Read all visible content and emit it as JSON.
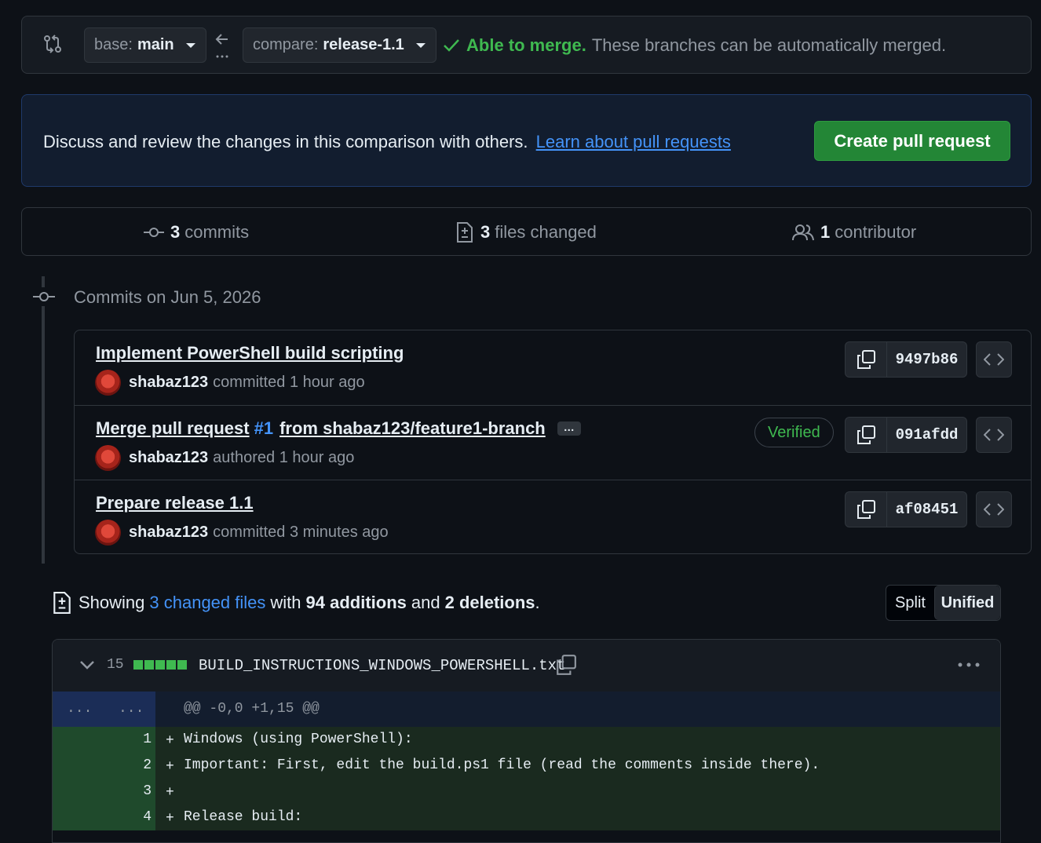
{
  "range": {
    "base_label": "base:",
    "base_branch": "main",
    "compare_label": "compare:",
    "compare_branch": "release-1.1",
    "merge_status": "Able to merge.",
    "merge_desc": "These branches can be automatically merged."
  },
  "blankslate": {
    "message": "Discuss and review the changes in this comparison with others.",
    "link": "Learn about pull requests",
    "button": "Create pull request"
  },
  "summary": {
    "commits_count": "3",
    "commits_label": "commits",
    "files_count": "3",
    "files_label": "files changed",
    "contributors_count": "1",
    "contributors_label": "contributor"
  },
  "timeline": {
    "title": "Commits on Jun 5, 2026"
  },
  "commits": [
    {
      "title": "Implement PowerShell build scripting",
      "author": "shabaz123",
      "action": "committed",
      "time": "1 hour ago",
      "sha": "9497b86"
    },
    {
      "title_pre": "Merge pull request",
      "pr_number": "#1",
      "title_post": "from shabaz123/feature1-branch",
      "ellipsis": "…",
      "author": "shabaz123",
      "action": "authored",
      "time": "1 hour ago",
      "badge": "Verified",
      "sha": "091afdd"
    },
    {
      "title": "Prepare release 1.1",
      "author": "shabaz123",
      "action": "committed",
      "time": "3 minutes ago",
      "sha": "af08451"
    }
  ],
  "diffstat": {
    "showing": "Showing",
    "files_link": "3 changed files",
    "with": "with",
    "additions": "94 additions",
    "and": "and",
    "deletions": "2 deletions",
    "period": ".",
    "split": "Split",
    "unified": "Unified"
  },
  "file": {
    "change_count": "15",
    "name": "BUILD_INSTRUCTIONS_WINDOWS_POWERSHELL.txt",
    "hunk_left": "...",
    "hunk_right": "...",
    "hunk_header": "@@ -0,0 +1,15 @@",
    "lines": [
      {
        "num": "1",
        "sign": "+",
        "text": "Windows (using PowerShell):"
      },
      {
        "num": "2",
        "sign": "+",
        "text": "Important: First, edit the build.ps1 file (read the comments inside there)."
      },
      {
        "num": "3",
        "sign": "+",
        "text": ""
      },
      {
        "num": "4",
        "sign": "+",
        "text": "Release build:"
      }
    ]
  },
  "colors": {
    "accent": "#4493f8",
    "success": "#3fb950",
    "button": "#238636",
    "bg": "#0d1117"
  }
}
